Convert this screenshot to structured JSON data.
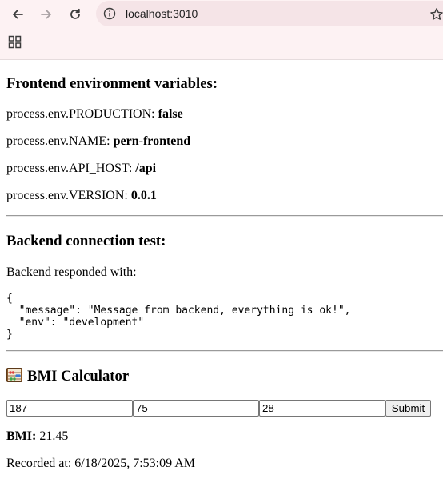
{
  "browser": {
    "url": "localhost:3010"
  },
  "frontend": {
    "heading": "Frontend environment variables:",
    "vars": [
      {
        "key": "process.env.PRODUCTION:",
        "value": "false"
      },
      {
        "key": "process.env.NAME:",
        "value": "pern-frontend"
      },
      {
        "key": "process.env.API_HOST:",
        "value": "/api"
      },
      {
        "key": "process.env.VERSION:",
        "value": "0.0.1"
      }
    ]
  },
  "backend": {
    "heading": "Backend connection test:",
    "responded_label": "Backend responded with:",
    "response_json": "{\n  \"message\": \"Message from backend, everything is ok!\",\n  \"env\": \"development\"\n}"
  },
  "bmi": {
    "heading": "BMI Calculator",
    "icon": "abacus-icon",
    "inputs": [
      "187",
      "75",
      "28"
    ],
    "submit_label": "Submit",
    "result_label": "BMI:",
    "result_value": "21.45",
    "recorded_at": "Recorded at: 6/18/2025, 7:53:09 AM"
  }
}
